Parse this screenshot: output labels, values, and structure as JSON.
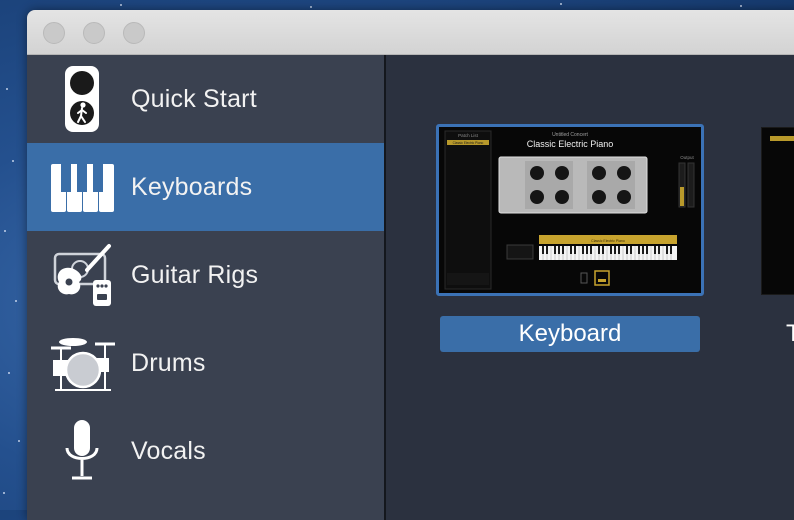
{
  "sidebar": {
    "items": [
      {
        "label": "Quick Start",
        "icon": "traffic-light-icon"
      },
      {
        "label": "Keyboards",
        "icon": "piano-keys-icon",
        "selected": true
      },
      {
        "label": "Guitar Rigs",
        "icon": "guitar-amp-icon"
      },
      {
        "label": "Drums",
        "icon": "drum-kit-icon"
      },
      {
        "label": "Vocals",
        "icon": "microphone-icon"
      }
    ]
  },
  "main": {
    "templates": [
      {
        "caption": "Keyboard",
        "selected": true,
        "preview": {
          "concert_title": "Untitled Concert",
          "patch_title": "Classic Electric Piano",
          "patch_list_label": "Patch List",
          "patch_item": "Classic Electric Piano",
          "output_label": "Output",
          "keyboard_label": "Classic Electric Piano"
        }
      },
      {
        "caption": "T"
      }
    ]
  },
  "colors": {
    "selection": "#3a6ea8",
    "sidebar_bg": "#3a4150",
    "main_bg": "#2b313f",
    "tile_border": "#3b72b6"
  }
}
